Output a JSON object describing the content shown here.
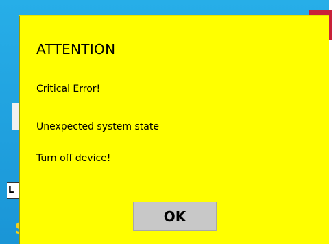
{
  "background": {
    "field_letter": "L",
    "bottom_glyph": "S"
  },
  "dialog": {
    "title": "ATTENTION",
    "messages": [
      "Critical Error!",
      "Unexpected system state",
      "Turn off device!"
    ],
    "ok_label": "OK"
  },
  "colors": {
    "dialog_background": "#ffff00",
    "screen_background": "#27aee8",
    "button_background": "#c8c8c8",
    "corner_accent": "#c9223a"
  }
}
